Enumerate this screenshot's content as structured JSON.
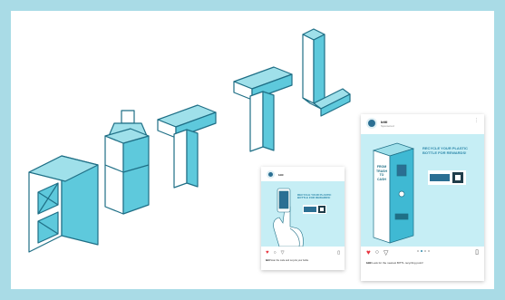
{
  "brand": {
    "wordmark": "BITTL"
  },
  "colors": {
    "frame": "#a9dbe6",
    "letter_fill": "#5ec9dc",
    "letter_stroke": "#1f6f86",
    "tile_bg": "#c6eef5",
    "heart": "#e8343e",
    "kiosk": "#3fb9d3"
  },
  "posts": {
    "small": {
      "handle": "bittl",
      "subtitle": "",
      "headline": "RECYCLE YOUR PLASTIC BOTTLE FOR REWARDS!",
      "caption_handle": "bittl",
      "caption_text": "Scan the code and recycle your bottle"
    },
    "large": {
      "handle": "bittl",
      "subtitle": "Sponsored",
      "headline": "RECYCLE YOUR PLASTIC BOTTLE FOR REWARDS!",
      "kiosk_text": [
        "FROM",
        "TRASH",
        "TO",
        "CASH"
      ],
      "caption_handle": "bittl",
      "caption_text": "Look for the nearest BITTL recycling point!"
    }
  }
}
